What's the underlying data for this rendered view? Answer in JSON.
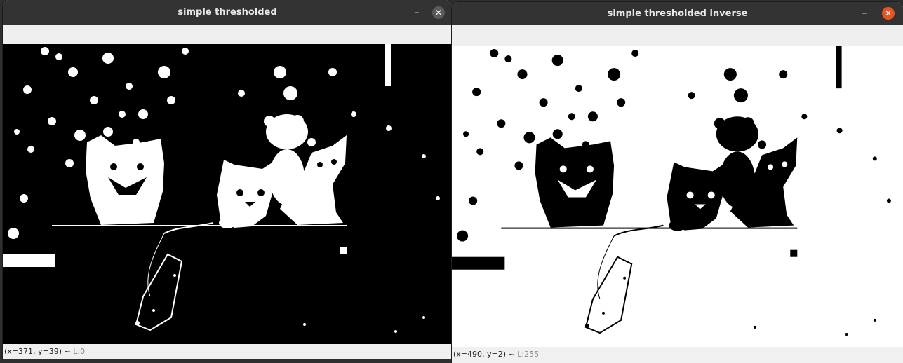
{
  "windows": [
    {
      "title": "simple thresholded",
      "minimize_glyph": "–",
      "close_glyph": "✕",
      "status": {
        "coords": "(x=371, y=39) ~ ",
        "lum": "L:0"
      },
      "image_mode": "threshold",
      "close_color": "#5a5a5a"
    },
    {
      "title": "simple thresholded inverse",
      "minimize_glyph": "–",
      "close_glyph": "✕",
      "status": {
        "coords": "(x=490, y=2) ~ ",
        "lum": "L:255"
      },
      "image_mode": "threshold-inverse",
      "close_color": "#e95420"
    }
  ],
  "icons": {
    "minimize": "minimize-icon",
    "close": "close-icon"
  }
}
